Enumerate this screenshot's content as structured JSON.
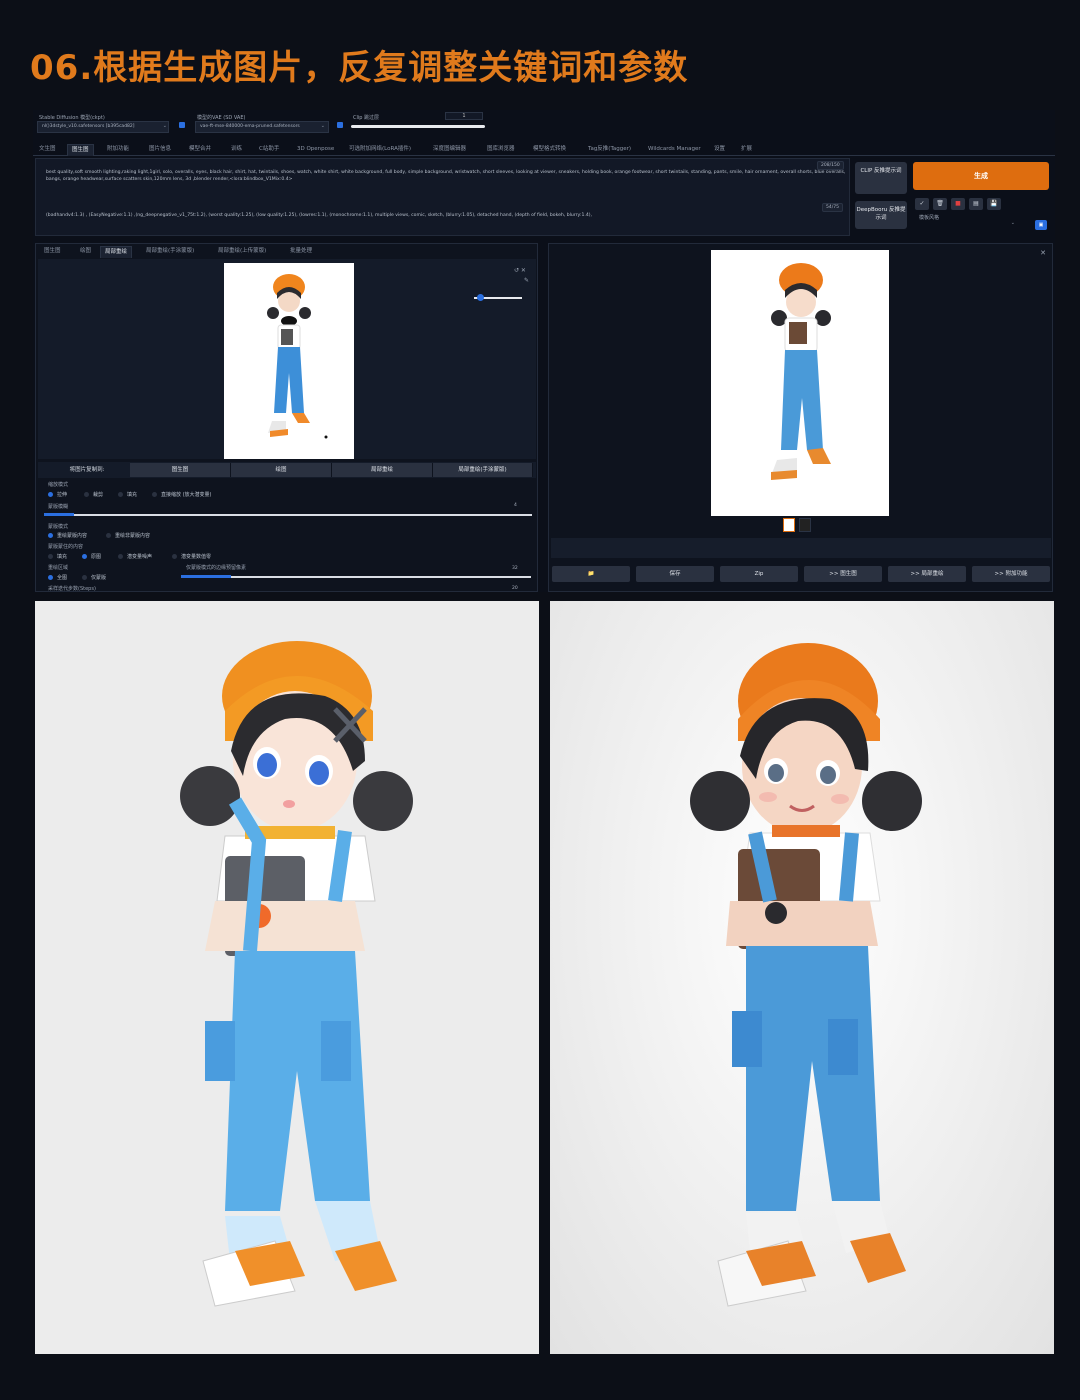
{
  "headline": "06.根据生成图片，反复调整关键词和参数",
  "topbar": {
    "sd_model_label": "Stable Diffusion 模型(ckpt)",
    "sd_model_value": "nl()3dstyle_v10.safetensors [b395cad82]",
    "vae_label": "模型的VAE (SD VAE)",
    "vae_value": "vae-ft-mse-840000-ema-pruned.safetensors",
    "clip_label": "Clip 跳过层",
    "clip_value": "1"
  },
  "tabs": [
    "文生图",
    "图生图",
    "附加功能",
    "图片信息",
    "模型合并",
    "训练",
    "C站助手",
    "3D Openpose",
    "可选附加网络(LoRA插件)",
    "深度图编辑器",
    "图库浏览器",
    "模型格式转换",
    "Tag反推(Tagger)",
    "Wildcards Manager",
    "设置",
    "扩展"
  ],
  "active_tab": "图生图",
  "prompt": {
    "positive": "best quality,soft smooth lighting,raking light,1girl, solo, overalls, eyes, black hair, shirt, hat, twintails, shoes, watch, white shirt, white background, full body, simple background, wristwatch, short sleeves, looking at viewer, sneakers, holding book, orange footwear, short twintails, standing, pants, smile, hair ornament, overall shorts, blue overalls, bangs, orange headwear,surface scatters skin,120mm lens, 3d ,blender render,<lora:blindbox_V1Mix:0.4>",
    "positive_count": "208/150",
    "negative": "(badhandv4:1.3) , (EasyNegative:1.1) ,(ng_deepnegative_v1_75t:1.2), (worst quality:1.25), (low quality:1.25), (lowres:1.1), (monochrome:1.1), multiple views, comic, sketch, (blurry:1.05), detached hand, (depth of field, bokeh, blurry:1.4),",
    "negative_count": "54/75"
  },
  "side_buttons": {
    "clip": "CLIP 反推提示词",
    "deepbooru": "DeepBooru 反推提示词",
    "generate": "生成",
    "style_label": "模板风格",
    "tool_icons": [
      "✓",
      "🗑",
      "■",
      "▤",
      "💾"
    ]
  },
  "img2img_tabs": [
    "图生图",
    "绘图",
    "局部重绘",
    "局部重绘(手涂蒙版)",
    "局部重绘(上传蒙版)",
    "批量处理"
  ],
  "img2img_active": "局部重绘",
  "copy_row": {
    "label": "将图片复制到:",
    "targets": [
      "图生图",
      "绘图",
      "局部重绘",
      "局部重绘(手涂蒙版)"
    ]
  },
  "options": {
    "resize_mode_label": "缩放模式",
    "resize_modes": [
      "拉伸",
      "裁剪",
      "填充",
      "直接缩放 (放大潜变量)"
    ],
    "mask_blur_label": "蒙版模糊",
    "mask_blur_value": "4",
    "mask_mode_label": "蒙版模式",
    "mask_modes": [
      "重绘蒙版内容",
      "重绘非蒙版内容"
    ],
    "fill_label": "蒙版蒙住的内容",
    "fill_modes": [
      "填充",
      "原图",
      "潜变量噪声",
      "潜变量数值零"
    ],
    "area_label": "重绘区域",
    "area_modes": [
      "全图",
      "仅蒙版"
    ],
    "padding_label": "仅蒙版模式的边缘预留像素",
    "padding_value": "32",
    "steps_label": "采样迭代步数(Steps)",
    "steps_value": "20"
  },
  "output_buttons": [
    "📁",
    "保存",
    "Zip",
    ">> 图生图",
    ">> 局部重绘",
    ">> 附加功能"
  ],
  "colors": {
    "accent": "#de6d0f",
    "headline": "#e07a1c",
    "background": "#0c0f17",
    "selection": "#2b6fe0"
  }
}
